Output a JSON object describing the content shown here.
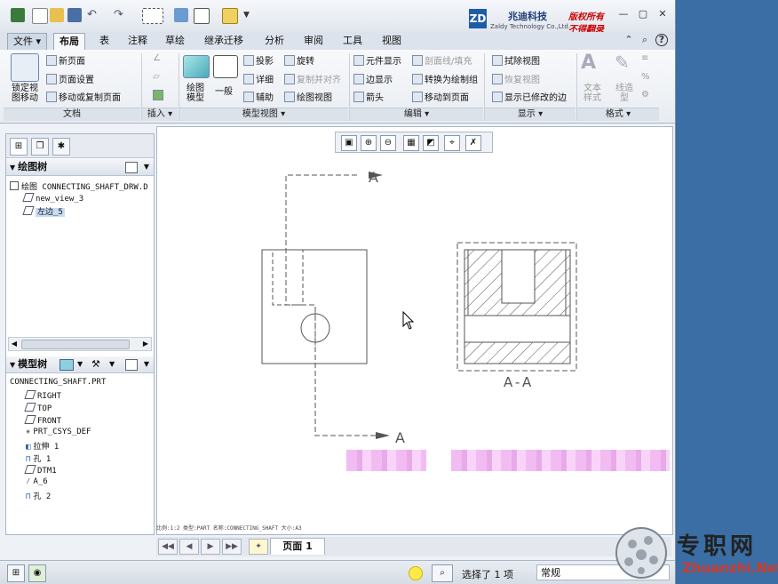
{
  "titlebar": {
    "logo_letter": "ZD",
    "company_cn": "兆迪科技",
    "company_en": "Zaldy Technology Co.,Ltd.",
    "rights1": "版权所有",
    "rights2": "不得翻录"
  },
  "menus": [
    "文件",
    "布局",
    "表",
    "注释",
    "草绘",
    "继承迁移",
    "分析",
    "审阅",
    "工具",
    "视图"
  ],
  "ribbon": {
    "doc": {
      "lock_view": "锁定视图移动",
      "new_page": "新页面",
      "page_setup": "页面设置",
      "move_copy_page": "移动或复制页面",
      "group": "文档"
    },
    "insert": {
      "group": "插入"
    },
    "model_views": {
      "drawing_model": "绘图模型",
      "general": "一般",
      "projection": "投影",
      "detail": "详细",
      "auxiliary": "辅助",
      "rotate": "旋转",
      "copy_align": "复制并对齐",
      "drawing_view": "绘图视图",
      "group": "模型视图"
    },
    "edit": {
      "element_display": "元件显示",
      "edge_display": "边显示",
      "arrow": "箭头",
      "section_fill": "剖面线/填充",
      "convert": "转换为绘制组",
      "move_to_page": "移动到页面",
      "group": "编辑"
    },
    "display": {
      "erase_view": "拭除视图",
      "restore_view": "恢复视图",
      "show_modified": "显示已修改的边",
      "group": "显示"
    },
    "format": {
      "text_style": "文本样式",
      "line_style": "线造型",
      "group": "格式"
    }
  },
  "drawing_tree": {
    "header": "绘图树",
    "items": [
      "绘图 CONNECTING_SHAFT_DRW.D",
      "new_view_3",
      "左边_5"
    ]
  },
  "model_tree": {
    "header": "模型树",
    "items": [
      "CONNECTING_SHAFT.PRT",
      "RIGHT",
      "TOP",
      "FRONT",
      "PRT_CSYS_DEF",
      "拉伸 1",
      "孔 1",
      "DTM1",
      "A_6",
      "孔 2"
    ]
  },
  "drawing": {
    "section_label_top": "A",
    "section_label_bottom": "A",
    "section_caption": "A-A",
    "status_line": "比例:1:2    类型:PART   名称:CONNECTING_SHAFT  大小:A3"
  },
  "pagebar": {
    "page_tab": "页面 1"
  },
  "statusbar": {
    "selected": "选择了 1 项",
    "filter": "常规"
  },
  "watermark": {
    "name": "专职网",
    "url": "Zhuanzhi.Net"
  },
  "colors": {
    "accent": "#1f5ca8",
    "hatch": "#555555",
    "selection": "#c8dcf4",
    "blur": "#f0b4f0"
  }
}
